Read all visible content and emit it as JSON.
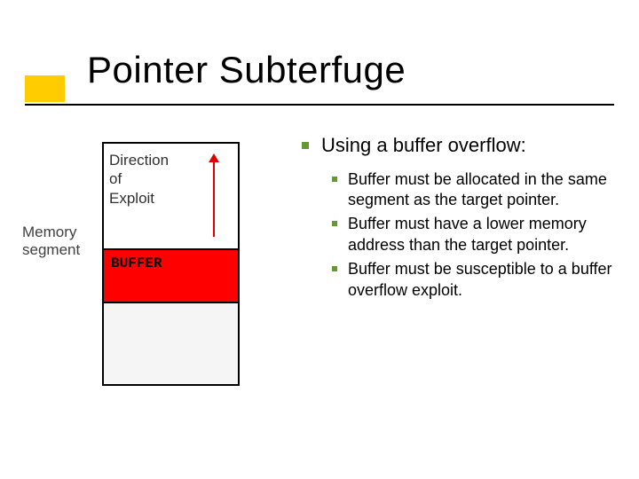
{
  "title": "Pointer Subterfuge",
  "diagram": {
    "memseg_label": "Memory\nsegment",
    "direction_label": "Direction\nof\nExploit",
    "buffer_label": "BUFFER"
  },
  "bullets": {
    "l1": "Using a buffer overflow:",
    "l2": [
      "Buffer must be allocated in the same segment as the target pointer.",
      "Buffer must have a lower memory address than the target pointer.",
      "Buffer must be susceptible to a buffer overflow exploit."
    ]
  }
}
